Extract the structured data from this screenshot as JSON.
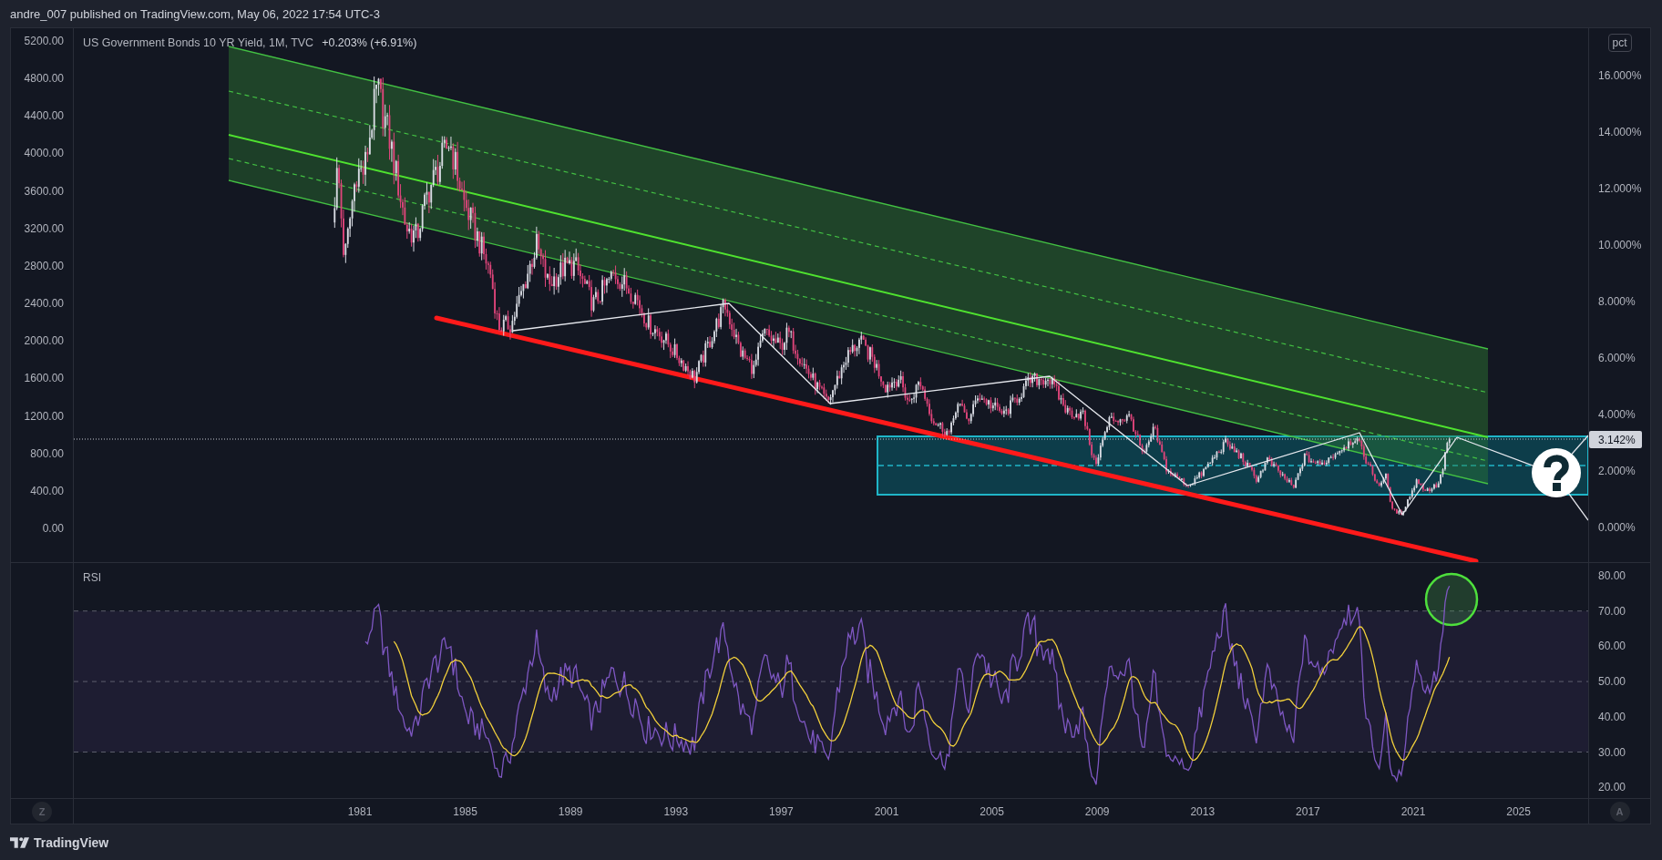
{
  "header": {
    "text": "andre_007 published on TradingView.com, May 06, 2022 17:54 UTC-3"
  },
  "price_pane": {
    "legend": {
      "title": "US Government Bonds 10 YR Yield, 1M, TVC",
      "change": "+0.203% (+6.91%)"
    },
    "left_axis": [
      "5200.00",
      "4800.00",
      "4400.00",
      "4000.00",
      "3600.00",
      "3200.00",
      "2800.00",
      "2400.00",
      "2000.00",
      "1600.00",
      "1200.00",
      "800.00",
      "400.00",
      "0.00"
    ],
    "right_axis": {
      "scale_button": "pct",
      "ticks": [
        "16.000%",
        "14.000%",
        "12.000%",
        "10.000%",
        "8.000%",
        "6.000%",
        "4.000%",
        "2.000%",
        "0.000%"
      ],
      "last_value": "3.142%"
    }
  },
  "rsi_pane": {
    "label": "RSI",
    "axis": [
      "80.00",
      "70.00",
      "60.00",
      "50.00",
      "40.00",
      "30.00",
      "20.00"
    ]
  },
  "time_axis": {
    "left_button": "Z",
    "ticks": [
      "1981",
      "1985",
      "1989",
      "1993",
      "1997",
      "2001",
      "2005",
      "2009",
      "2013",
      "2017",
      "2021",
      "2025"
    ],
    "right_button": "A"
  },
  "footer": {
    "brand": "TradingView"
  }
}
